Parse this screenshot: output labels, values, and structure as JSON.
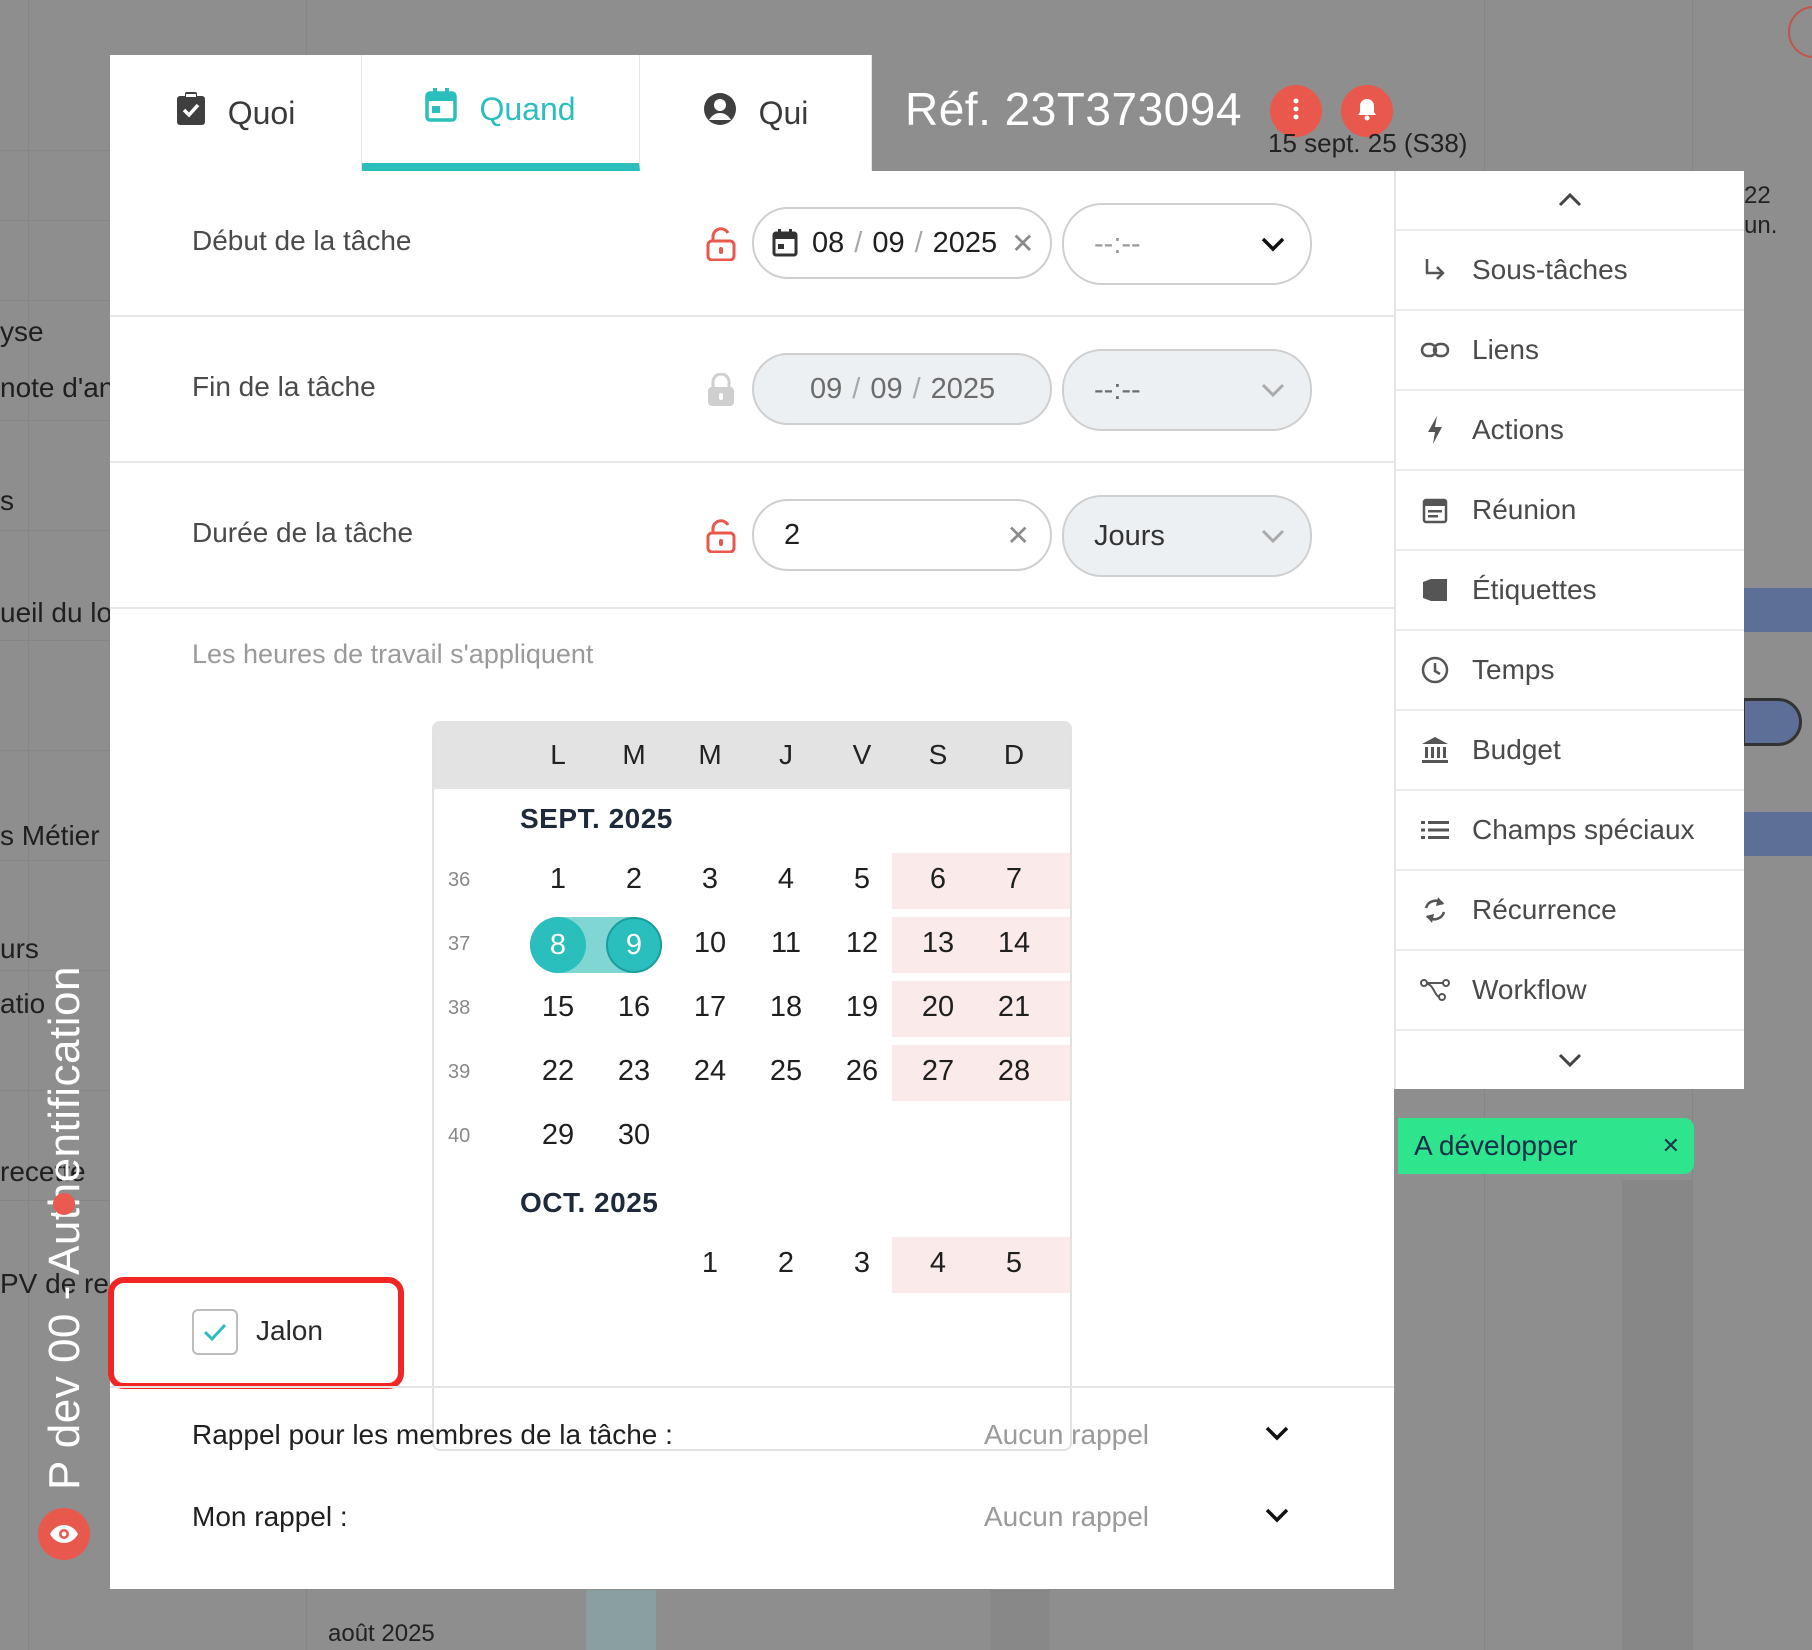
{
  "background": {
    "labels": [
      "yse",
      "note d'ana",
      "s",
      "ueil du lo",
      "s Métier",
      "urs",
      "atio",
      "recette",
      "PV de rec"
    ],
    "project_title": "P dev 00 - Authentification",
    "month_label": "août 2025",
    "right_texts": [
      "22",
      "un."
    ]
  },
  "tabs": [
    {
      "label": "Quoi",
      "icon": "clipboard-check-icon"
    },
    {
      "label": "Quand",
      "icon": "calendar-icon"
    },
    {
      "label": "Qui",
      "icon": "user-circle-icon"
    }
  ],
  "header": {
    "ref": "Réf. 23T373094",
    "week": "15 sept. 25 (S38)"
  },
  "rows": {
    "start": {
      "label": "Début de la tâche",
      "day": "08",
      "month": "09",
      "year": "2025",
      "time_placeholder": "--:--"
    },
    "end": {
      "label": "Fin de la tâche",
      "day": "09",
      "month": "09",
      "year": "2025",
      "time_placeholder": "--:--"
    },
    "duration": {
      "label": "Durée de la tâche",
      "value": "2",
      "unit": "Jours"
    }
  },
  "hint": "Les heures de travail s'appliquent",
  "calendar": {
    "weekdays": [
      "L",
      "M",
      "M",
      "J",
      "V",
      "S",
      "D"
    ],
    "months": [
      {
        "title": "SEPT. 2025",
        "weeks": [
          {
            "no": "36",
            "days": [
              "1",
              "2",
              "3",
              "4",
              "5",
              "6",
              "7"
            ],
            "offset": 0
          },
          {
            "no": "37",
            "days": [
              "8",
              "9",
              "10",
              "11",
              "12",
              "13",
              "14"
            ],
            "offset": 0
          },
          {
            "no": "38",
            "days": [
              "15",
              "16",
              "17",
              "18",
              "19",
              "20",
              "21"
            ],
            "offset": 0
          },
          {
            "no": "39",
            "days": [
              "22",
              "23",
              "24",
              "25",
              "26",
              "27",
              "28"
            ],
            "offset": 0
          },
          {
            "no": "40",
            "days": [
              "29",
              "30"
            ],
            "offset": 0
          }
        ]
      },
      {
        "title": "OCT. 2025",
        "weeks": [
          {
            "no": "",
            "days": [
              "1",
              "2",
              "3",
              "4",
              "5"
            ],
            "offset": 2
          }
        ]
      }
    ],
    "selected": [
      "8",
      "9"
    ]
  },
  "jalon": {
    "label": "Jalon",
    "checked": true
  },
  "reminders": {
    "members_label": "Rappel pour les membres de la tâche :",
    "members_value": "Aucun rappel",
    "mine_label": "Mon rappel :",
    "mine_value": "Aucun rappel"
  },
  "side_menu": [
    {
      "label": "Sous-tâches",
      "icon": "subtask-arrow-icon"
    },
    {
      "label": "Liens",
      "icon": "link-icon"
    },
    {
      "label": "Actions",
      "icon": "lightning-icon"
    },
    {
      "label": "Réunion",
      "icon": "calendar-event-icon"
    },
    {
      "label": "Étiquettes",
      "icon": "tag-icon"
    },
    {
      "label": "Temps",
      "icon": "clock-icon"
    },
    {
      "label": "Budget",
      "icon": "bank-icon"
    },
    {
      "label": "Champs spéciaux",
      "icon": "list-icon"
    },
    {
      "label": "Récurrence",
      "icon": "recurrence-icon"
    },
    {
      "label": "Workflow",
      "icon": "workflow-icon"
    }
  ],
  "status_tag": {
    "label": "A développer"
  },
  "colors": {
    "accent": "#2abfbd",
    "danger": "#e8584d",
    "tag": "#2ee48c",
    "highlight": "#f02525"
  }
}
